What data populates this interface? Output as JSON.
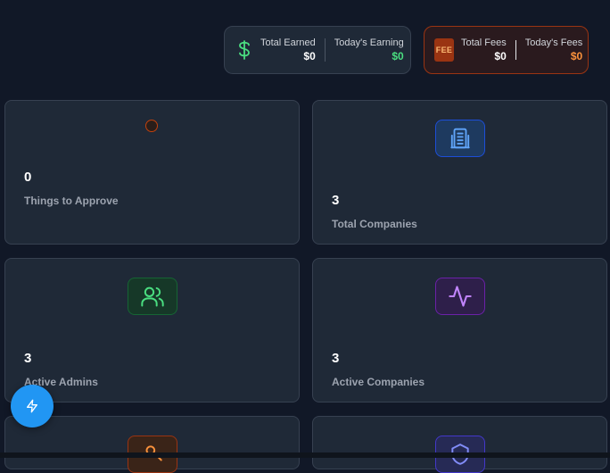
{
  "earnings": {
    "total_earned_label": "Total Earned",
    "total_earned_value": "$0",
    "todays_earning_label": "Today's Earning",
    "todays_earning_value": "$0"
  },
  "fees": {
    "badge": "FEE",
    "total_fees_label": "Total Fees",
    "total_fees_value": "$0",
    "todays_fees_label": "Today's Fees",
    "todays_fees_value": "$0"
  },
  "cards": [
    {
      "value": "0",
      "label": "Things to Approve",
      "icon": "loading-ring-icon"
    },
    {
      "value": "3",
      "label": "Total Companies",
      "icon": "building-icon",
      "color": "#3b82f6"
    },
    {
      "value": "3",
      "label": "Active Admins",
      "icon": "users-icon",
      "color": "#4ade80"
    },
    {
      "value": "3",
      "label": "Active Companies",
      "icon": "activity-icon",
      "color": "#c084fc"
    },
    {
      "icon": "user-icon",
      "color": "#fb923c"
    },
    {
      "icon": "shield-icon",
      "color": "#818cf8"
    }
  ],
  "fab": {
    "icon": "lightning-icon"
  },
  "colors": {
    "background": "#111827",
    "card": "#1f2937",
    "accent_blue": "#2196f3",
    "green": "#4ade80",
    "orange": "#fb923c"
  }
}
